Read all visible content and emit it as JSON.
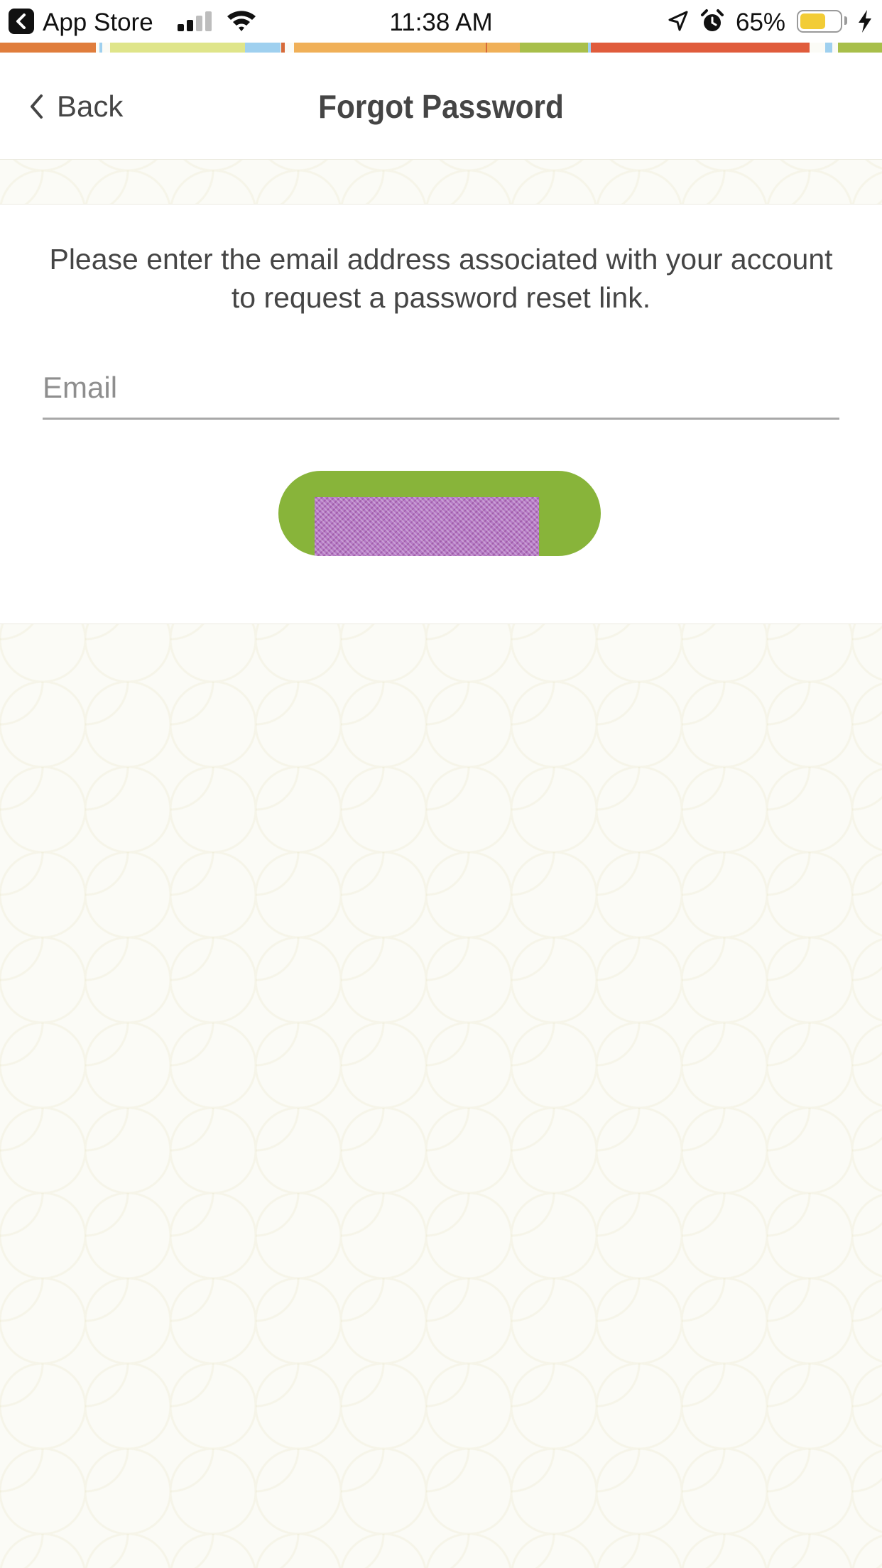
{
  "status_bar": {
    "back_app_label": "App Store",
    "time": "11:38 AM",
    "battery_percent_text": "65%",
    "battery_level": 0.65,
    "signal_bars": 2
  },
  "nav": {
    "back_label": "Back",
    "title": "Forgot Password"
  },
  "form": {
    "instructions": "Please enter the email address associated with your account to request a password reset link.",
    "email_placeholder": "Email",
    "email_value": "",
    "submit_label": ""
  },
  "colors": {
    "accent_green": "#88b43a",
    "text_dark": "#454545",
    "background": "#fbfbf6"
  },
  "icons": [
    "back-app-icon",
    "signal-icon",
    "wifi-icon",
    "chevron-left-icon",
    "location-icon",
    "alarm-icon",
    "battery-icon",
    "charging-icon"
  ]
}
